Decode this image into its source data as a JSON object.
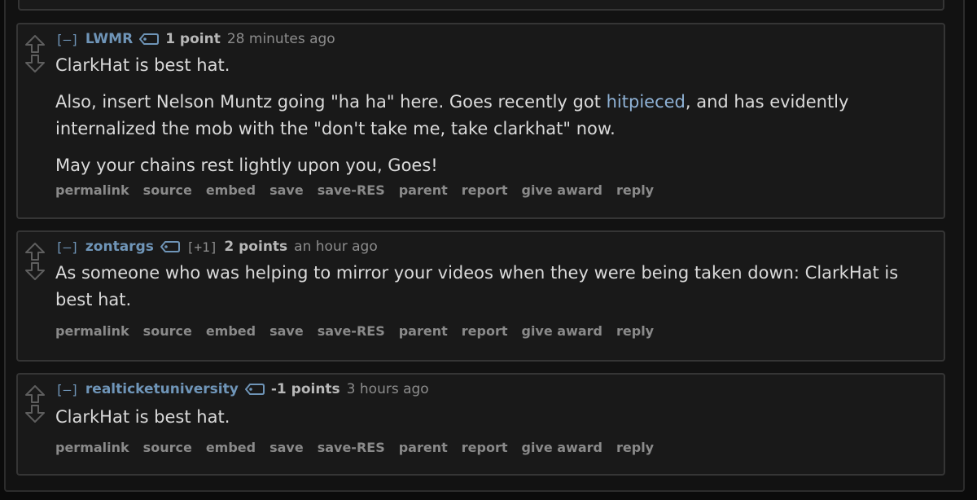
{
  "comments": [
    {
      "collapse": "[–]",
      "author": "LWMR",
      "flair": "",
      "score": "1 point",
      "time": "28 minutes ago",
      "body": [
        {
          "segments": [
            {
              "text": "ClarkHat is best hat."
            }
          ]
        },
        {
          "segments": [
            {
              "text": "Also, insert Nelson Muntz going \"ha ha\" here. Goes recently got "
            },
            {
              "text": "hitpieced",
              "link": true
            },
            {
              "text": ", and has evidently internalized the mob with the \"don't take me, take clarkhat\" now."
            }
          ]
        },
        {
          "segments": [
            {
              "text": "May your chains rest lightly upon you, Goes!"
            }
          ]
        }
      ]
    },
    {
      "collapse": "[–]",
      "author": "zontargs",
      "flair": "[+1]",
      "score": "2 points",
      "time": "an hour ago",
      "body": [
        {
          "segments": [
            {
              "text": "As someone who was helping to mirror your videos when they were being taken down: ClarkHat is best hat."
            }
          ]
        }
      ]
    },
    {
      "collapse": "[–]",
      "author": "realticketuniversity",
      "flair": "",
      "score": "-1 points",
      "time": "3 hours ago",
      "body": [
        {
          "segments": [
            {
              "text": "ClarkHat is best hat."
            }
          ]
        }
      ]
    }
  ],
  "buttons": [
    "permalink",
    "source",
    "embed",
    "save",
    "save-RES",
    "parent",
    "report",
    "give award",
    "reply"
  ],
  "colors": {
    "author": "#6f95b8",
    "link": "#8fb2d6",
    "background": "#191919",
    "border": "#353535"
  },
  "icons": {
    "upvote": "upvote-arrow-icon",
    "downvote": "downvote-arrow-icon",
    "tag": "tag-icon"
  }
}
